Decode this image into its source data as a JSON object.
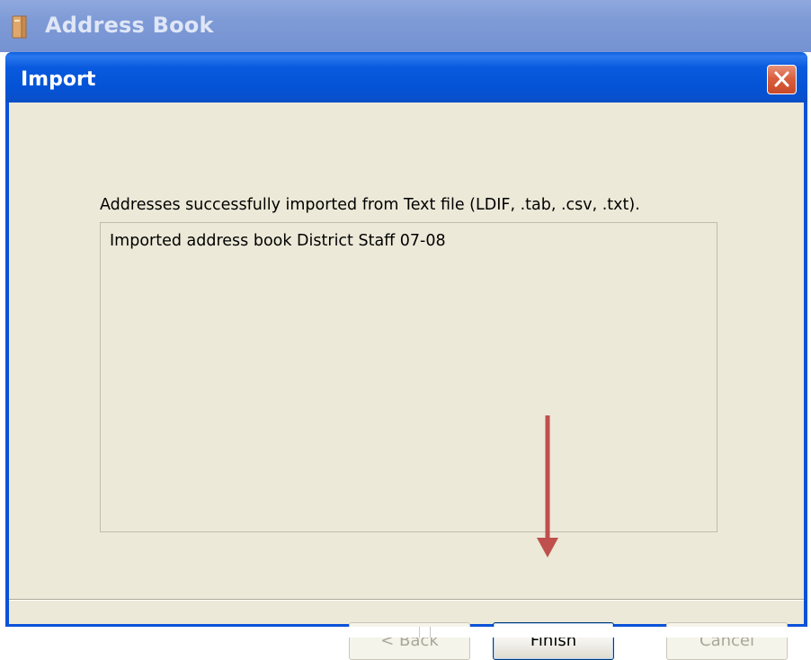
{
  "background_window": {
    "title": "Address Book",
    "icon": "address-book-icon"
  },
  "dialog": {
    "title": "Import",
    "close_icon": "close-icon",
    "message": "Addresses successfully imported from Text file (LDIF, .tab, .csv, .txt).",
    "log_items": [
      "Imported address book District Staff 07-08"
    ],
    "buttons": {
      "back": "< Back",
      "finish": "Finish",
      "cancel": "Cancel"
    }
  },
  "annotation": {
    "type": "arrow",
    "color": "#c0504d",
    "points_to": "finish-button"
  },
  "colors": {
    "titlebar_blue": "#0453d6",
    "dialog_face": "#ece9d8",
    "close_red": "#d9603f"
  }
}
